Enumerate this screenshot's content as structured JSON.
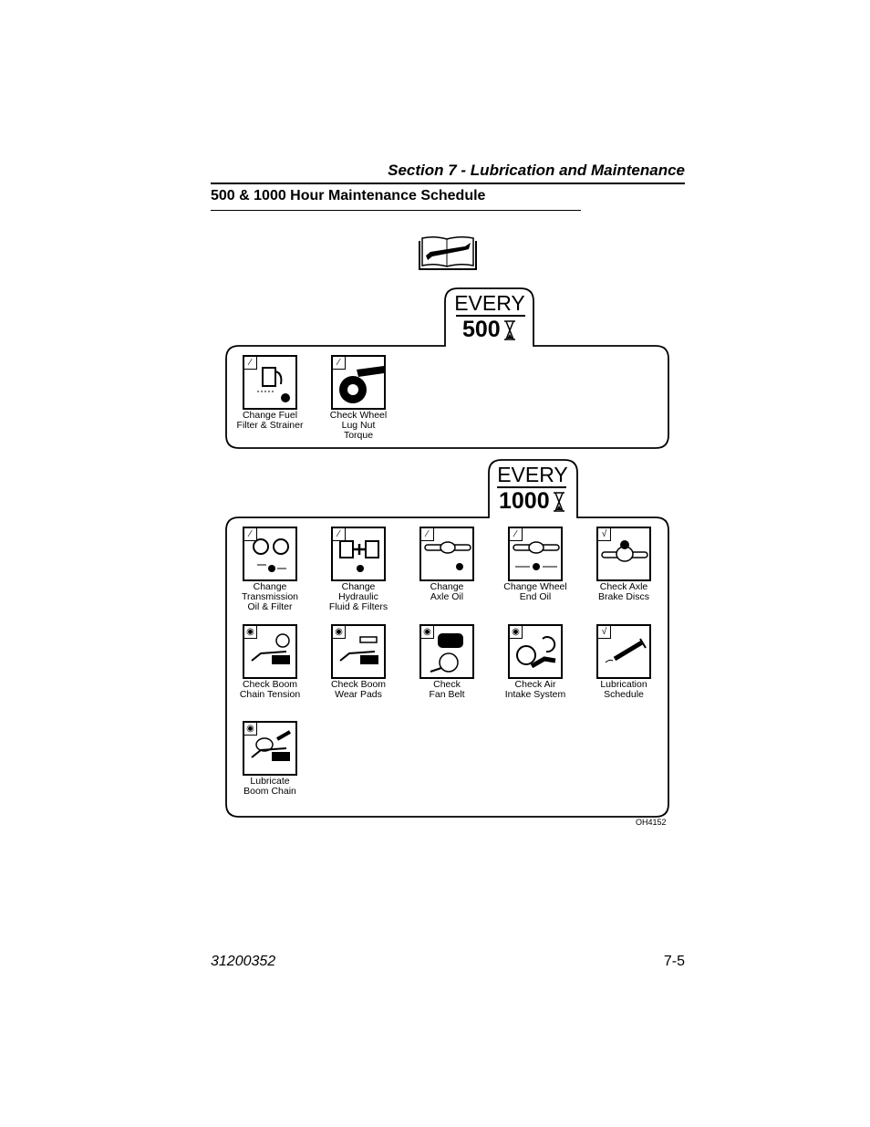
{
  "header": {
    "section_title": "Section 7 - Lubrication and Maintenance",
    "subtitle": "500 & 1000 Hour Maintenance Schedule"
  },
  "manual_icon": "book-wrench-icon",
  "schedule_500": {
    "every_label": "EVERY",
    "hours": "500",
    "hours_icon": "hourglass-icon",
    "items": [
      {
        "label": "Change Fuel\nFilter & Strainer",
        "badge": "wrench",
        "icon": "fuel-pump-icon"
      },
      {
        "label": "Check Wheel\nLug Nut\nTorque",
        "badge": "wrench",
        "icon": "wheel-torque-icon"
      }
    ]
  },
  "schedule_1000": {
    "every_label": "EVERY",
    "hours": "1000",
    "hours_icon": "hourglass-icon",
    "items": [
      {
        "label": "Change\nTransmission\nOil & Filter",
        "badge": "wrench",
        "icon": "transmission-oil-icon"
      },
      {
        "label": "Change\nHydraulic\nFluid & Filters",
        "badge": "wrench",
        "icon": "hydraulic-fluid-icon"
      },
      {
        "label": "Change\nAxle Oil",
        "badge": "wrench",
        "icon": "axle-oil-icon"
      },
      {
        "label": "Change Wheel\nEnd Oil",
        "badge": "wrench",
        "icon": "wheel-end-oil-icon"
      },
      {
        "label": "Check Axle\nBrake Discs",
        "badge": "check",
        "icon": "axle-brake-icon"
      },
      {
        "label": "Check Boom\nChain Tension",
        "badge": "eye",
        "icon": "boom-chain-icon"
      },
      {
        "label": "Check Boom\nWear Pads",
        "badge": "eye",
        "icon": "boom-wear-pads-icon"
      },
      {
        "label": "Check\nFan Belt",
        "badge": "eye",
        "icon": "fan-belt-icon"
      },
      {
        "label": "Check Air\nIntake System",
        "badge": "eye",
        "icon": "air-intake-icon"
      },
      {
        "label": "Lubrication\nSchedule",
        "badge": "check",
        "icon": "grease-gun-icon"
      },
      {
        "label": "Lubricate\nBoom Chain",
        "badge": "eye",
        "icon": "boom-chain-lube-icon"
      }
    ]
  },
  "figure_id": "OH4152",
  "footer": {
    "doc_number": "31200352",
    "page_number": "7-5"
  }
}
